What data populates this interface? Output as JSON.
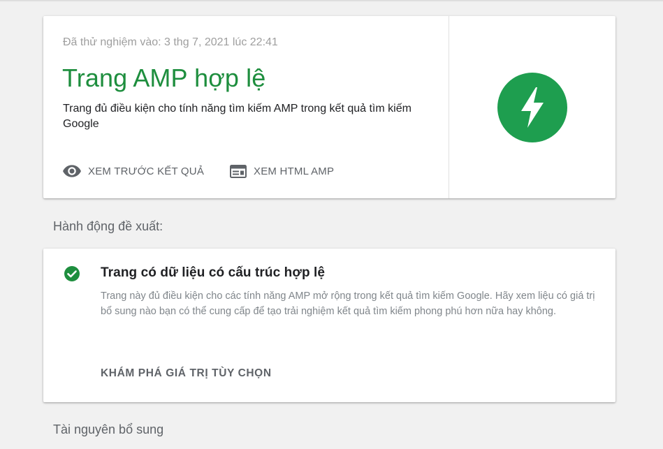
{
  "result": {
    "tested_date": "Đã thử nghiệm vào: 3 thg 7, 2021 lúc 22:41",
    "title": "Trang AMP hợp lệ",
    "description": "Trang đủ điều kiện cho tính năng tìm kiếm AMP trong kết quả tìm kiếm Google",
    "actions": [
      {
        "label": "XEM TRƯỚC KẾT QUẢ",
        "icon": "eye-icon"
      },
      {
        "label": "XEM HTML AMP",
        "icon": "web-page-icon"
      }
    ],
    "badge_icon": "amp-lightning-icon"
  },
  "sections": {
    "suggested_actions": "Hành động đề xuất:",
    "additional_resources": "Tài nguyên bổ sung"
  },
  "suggestion": {
    "icon": "check-circle-icon",
    "title": "Trang có dữ liệu có cấu trúc hợp lệ",
    "description": "Trang này đủ điều kiện cho các tính năng AMP mở rộng trong kết quả tìm kiếm Google. Hãy xem liệu có giá trị bổ sung nào bạn có thể cung cấp để tạo trải nghiệm kết quả tìm kiếm phong phú hơn nữa hay không.",
    "action_label": "KHÁM PHÁ GIÁ TRỊ TÙY CHỌN"
  },
  "colors": {
    "success_green": "#1e8e3e",
    "badge_green": "#1e9e4f",
    "background": "#f1f1f1"
  }
}
